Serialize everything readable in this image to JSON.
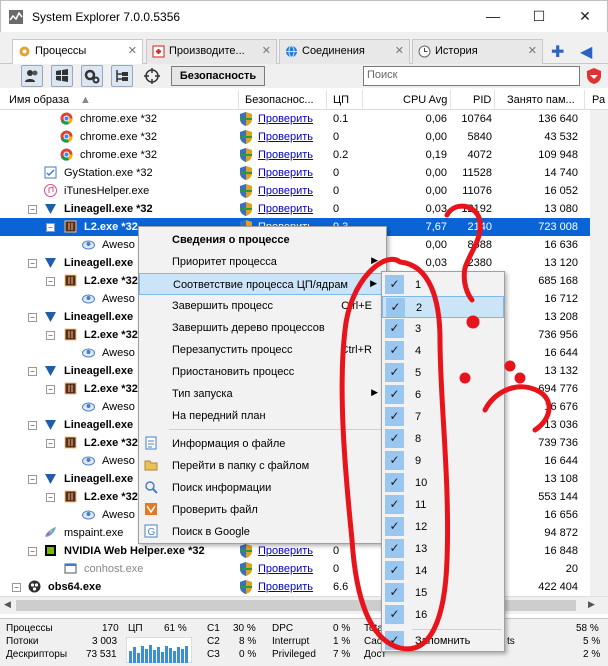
{
  "window": {
    "title": "System Explorer 7.0.0.5356",
    "minimize": "—",
    "maximize": "☐",
    "close": "✕"
  },
  "tabs": [
    {
      "label": "Процессы",
      "active": true,
      "close": "✕"
    },
    {
      "label": "Производите...",
      "close": "✕"
    },
    {
      "label": "Соединения",
      "close": "✕"
    },
    {
      "label": "История",
      "close": "✕"
    }
  ],
  "tab_buttons": {
    "add": "✚",
    "nav": "◀"
  },
  "toolbar": {
    "security_label": "Безопасность",
    "search_placeholder": "Поиск"
  },
  "columns": {
    "name": "Имя образа",
    "security": "Безопаснос...",
    "cpu": "ЦП",
    "cpu_avg": "CPU Avg",
    "pid": "PID",
    "memory": "Занято пам...",
    "extra": "Ра"
  },
  "rows": [
    {
      "name": "chrome.exe *32",
      "check": "Проверить",
      "cpu": "0.1",
      "avg": "0,06",
      "pid": "10764",
      "mem": "136 640"
    },
    {
      "name": "chrome.exe *32",
      "check": "Проверить",
      "cpu": "0",
      "avg": "0,00",
      "pid": "5840",
      "mem": "43 532"
    },
    {
      "name": "chrome.exe *32",
      "check": "Проверить",
      "cpu": "0.2",
      "avg": "0,19",
      "pid": "4072",
      "mem": "109 948"
    },
    {
      "name": "GyStation.exe *32",
      "check": "Проверить",
      "cpu": "0",
      "avg": "0,00",
      "pid": "11528",
      "mem": "14 740"
    },
    {
      "name": "iTunesHelper.exe",
      "check": "Проверить",
      "cpu": "0",
      "avg": "0,00",
      "pid": "11076",
      "mem": "16 052"
    },
    {
      "name": "Lineagell.exe *32",
      "check": "Проверить",
      "cpu": "0",
      "avg": "0,03",
      "pid": "12192",
      "mem": "13 080"
    },
    {
      "name": "L2.exe *32",
      "check": "Проверить",
      "cpu": "9.3",
      "avg": "7,67",
      "pid": "2140",
      "mem": "723 008"
    },
    {
      "name": "Aweso",
      "check": "",
      "cpu": "",
      "avg": "0,00",
      "pid": "8588",
      "mem": "16 636"
    },
    {
      "name": "Lineagell.exe",
      "check": "",
      "cpu": "",
      "avg": "0,03",
      "pid": "2380",
      "mem": "13 120"
    },
    {
      "name": "L2.exe *32",
      "check": "",
      "cpu": "",
      "avg": "",
      "pid": "",
      "mem": "685 168"
    },
    {
      "name": "Aweso",
      "check": "",
      "cpu": "",
      "avg": "",
      "pid": "",
      "mem": "16 712"
    },
    {
      "name": "Lineagell.exe",
      "check": "",
      "cpu": "",
      "avg": "",
      "pid": "",
      "mem": "13 208"
    },
    {
      "name": "L2.exe *32",
      "check": "",
      "cpu": "",
      "avg": "",
      "pid": "",
      "mem": "736 956"
    },
    {
      "name": "Aweso",
      "check": "",
      "cpu": "",
      "avg": "",
      "pid": "",
      "mem": "16 644"
    },
    {
      "name": "Lineagell.exe",
      "check": "",
      "cpu": "",
      "avg": "",
      "pid": "",
      "mem": "13 132"
    },
    {
      "name": "L2.exe *32",
      "check": "",
      "cpu": "",
      "avg": "",
      "pid": "",
      "mem": "694 776"
    },
    {
      "name": "Aweso",
      "check": "",
      "cpu": "",
      "avg": "",
      "pid": "",
      "mem": "16 676"
    },
    {
      "name": "Lineagell.exe",
      "check": "",
      "cpu": "",
      "avg": "",
      "pid": "",
      "mem": "13 036"
    },
    {
      "name": "L2.exe *32",
      "check": "",
      "cpu": "",
      "avg": "",
      "pid": "",
      "mem": "739 736"
    },
    {
      "name": "Aweso",
      "check": "",
      "cpu": "",
      "avg": "",
      "pid": "",
      "mem": "16 644"
    },
    {
      "name": "Lineagell.exe",
      "check": "",
      "cpu": "",
      "avg": "",
      "pid": "",
      "mem": "13 108"
    },
    {
      "name": "L2.exe *32",
      "check": "",
      "cpu": "",
      "avg": "",
      "pid": "",
      "mem": "553 144"
    },
    {
      "name": "Aweso",
      "check": "",
      "cpu": "",
      "avg": "",
      "pid": "",
      "mem": "16 656"
    },
    {
      "name": "mspaint.exe",
      "check": "",
      "cpu": "",
      "avg": "",
      "pid": "",
      "mem": "94 872"
    },
    {
      "name": "NVIDIA Web Helper.exe *32",
      "check": "Проверить",
      "cpu": "0",
      "avg": "",
      "pid": "",
      "mem": "16 848"
    },
    {
      "name": "conhost.exe",
      "check": "Проверить",
      "cpu": "0",
      "avg": "",
      "pid": "",
      "mem": "20"
    },
    {
      "name": "obs64.exe",
      "check": "Проверить",
      "cpu": "6.6",
      "avg": "",
      "pid": "",
      "mem": "422 404"
    }
  ],
  "context_menu": {
    "items": [
      "Сведения о процессе",
      "Приоритет процесса",
      "Соответствие процесса ЦП/ядрам",
      "Завершить процесс",
      "Завершить дерево процессов",
      "Перезапустить процесс",
      "Приостановить процесс",
      "Тип запуска",
      "На передний план",
      "Информация о файле",
      "Перейти в папку с файлом",
      "Поиск информации",
      "Проверить файл",
      "Поиск в Google"
    ],
    "shortcuts": {
      "kill": "Ctrl+E",
      "restart": "Ctrl+R"
    }
  },
  "affinity_menu": {
    "cores": [
      "1",
      "2",
      "3",
      "4",
      "5",
      "6",
      "7",
      "8",
      "9",
      "10",
      "11",
      "12",
      "13",
      "14",
      "15",
      "16"
    ],
    "remember": "Запомнить",
    "check": "✓"
  },
  "status": {
    "processes_label": "Процессы",
    "processes": "170",
    "threads_label": "Потоки",
    "threads": "3 003",
    "handles_label": "Дескрипторы",
    "handles": "73 531",
    "cpu_label": "ЦП",
    "cpu": "61 %",
    "c1_label": "C1",
    "c1": "30 %",
    "c2_label": "C2",
    "c2": "8 %",
    "c3_label": "C3",
    "c3": "0 %",
    "dpc_label": "DPC",
    "dpc": "0 %",
    "interrupt_label": "Interrupt",
    "interrupt": "1 %",
    "privileged_label": "Privileged",
    "privileged": "7 %",
    "total_label": "Tota",
    "cache_label": "Cac",
    "avail_label": "Дост",
    "pct1": "58 %",
    "pct2": "5 %",
    "pct3": "2 %",
    "ts": "ts"
  },
  "icons": [
    "app-logo-icon",
    "processes-tab-icon",
    "performance-tab-icon",
    "connections-tab-icon",
    "history-tab-icon",
    "users-icon",
    "windows-icon",
    "gears-icon",
    "tree-icon",
    "target-icon",
    "shield-icon",
    "chrome-icon",
    "itunes-icon",
    "lineage-icon",
    "l2-icon",
    "awesomium-icon",
    "paint-icon",
    "nvidia-icon",
    "obs-icon"
  ],
  "colors": {
    "selection": "#0a64d6",
    "link": "#0000cc",
    "menu_highlight": "#cce4f7",
    "check_bg": "#9ac7f0",
    "annotation": "#e8141b"
  }
}
